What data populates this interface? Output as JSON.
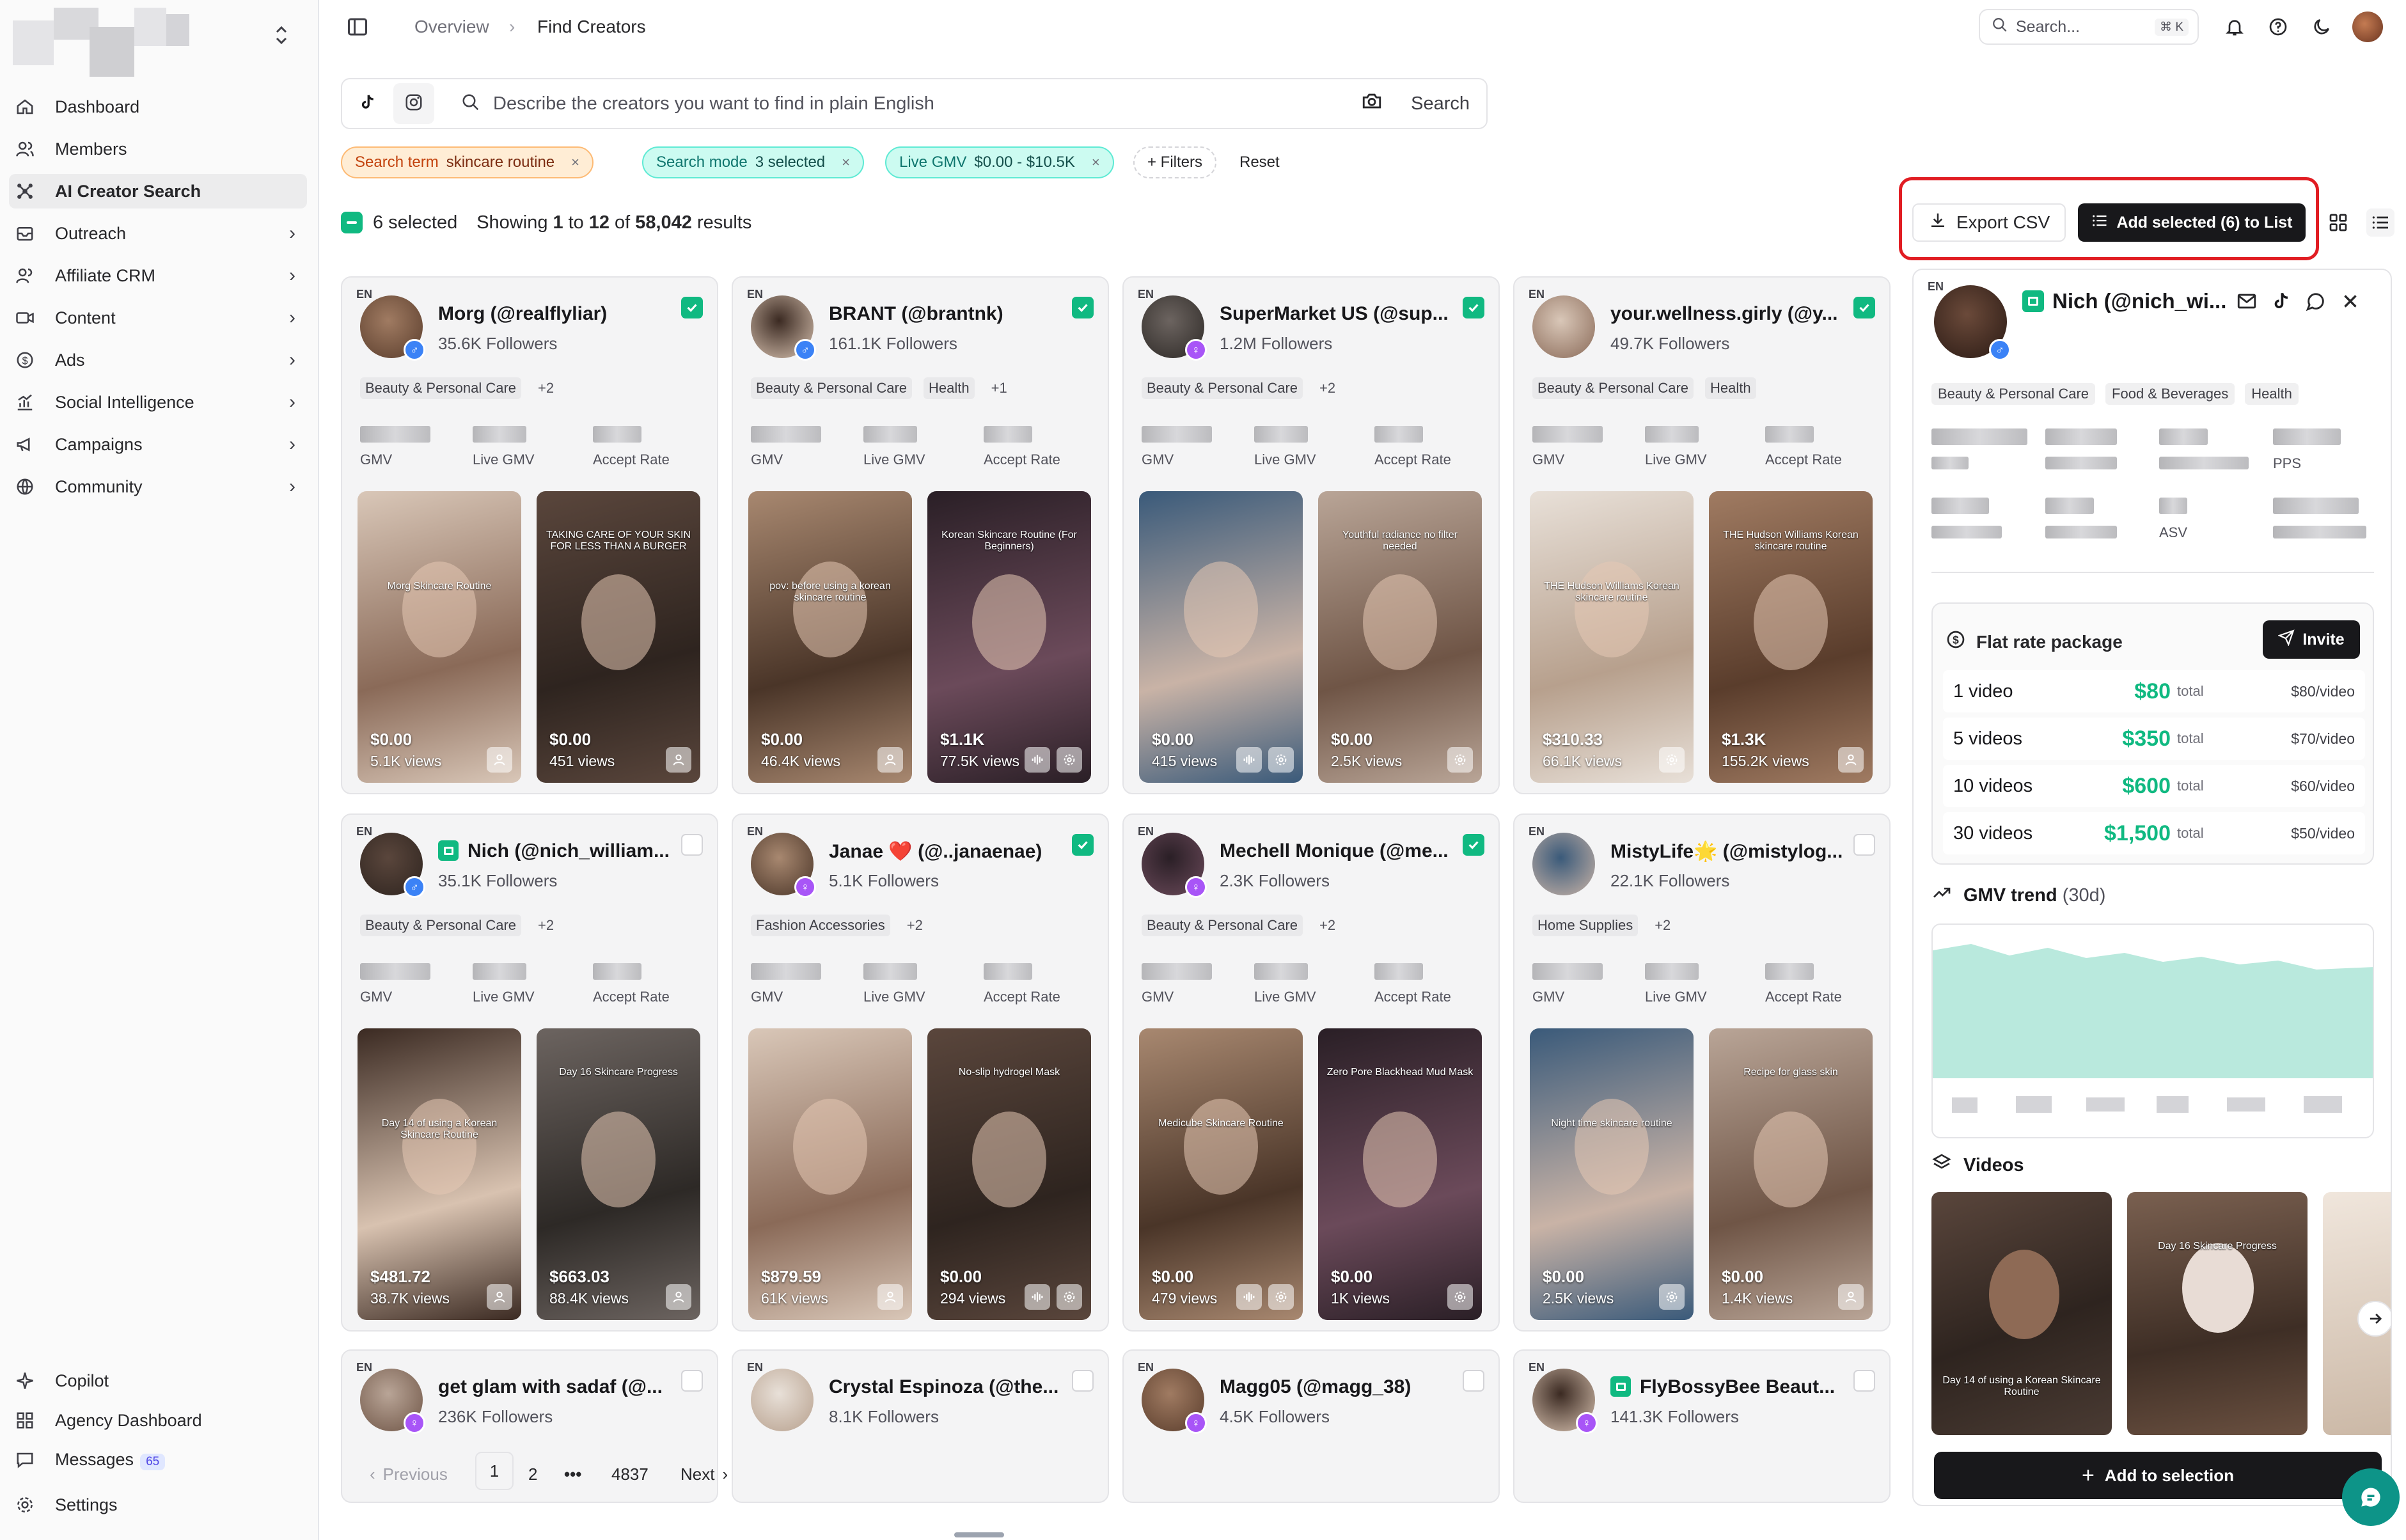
{
  "sidebar": {
    "items": [
      {
        "label": "Dashboard"
      },
      {
        "label": "Members"
      },
      {
        "label": "AI Creator Search"
      },
      {
        "label": "Outreach"
      },
      {
        "label": "Affiliate CRM"
      },
      {
        "label": "Content"
      },
      {
        "label": "Ads"
      },
      {
        "label": "Social Intelligence"
      },
      {
        "label": "Campaigns"
      },
      {
        "label": "Community"
      }
    ],
    "bottom": [
      {
        "label": "Copilot"
      },
      {
        "label": "Agency Dashboard"
      },
      {
        "label": "Messages",
        "badge": "65"
      },
      {
        "label": "Settings"
      }
    ]
  },
  "breadcrumb": {
    "parent": "Overview",
    "sep": "›",
    "current": "Find Creators"
  },
  "topsearch": {
    "placeholder": "Search...",
    "shortcut": "⌘ K"
  },
  "query": {
    "placeholder": "Describe the creators you want to find in plain English",
    "search_label": "Search"
  },
  "chips": {
    "term_label": "Search term",
    "term_value": "skincare routine",
    "mode_label": "Search mode",
    "mode_value": "3 selected",
    "gmv_label": "Live GMV",
    "gmv_value": "$0.00 - $10.5K",
    "filters": "+ Filters",
    "reset": "Reset",
    "remove": "×"
  },
  "results": {
    "selected": "6 selected",
    "showing_prefix": "Showing",
    "from": "1",
    "to_word": "to",
    "to": "12",
    "of_word": "of",
    "total": "58,042",
    "suffix": "results",
    "export": "Export CSV",
    "add_to_list": "Add selected (6) to List"
  },
  "card_labels": {
    "lang": "EN",
    "gmv": "GMV",
    "live_gmv": "Live GMV",
    "accept_rate": "Accept Rate"
  },
  "cards": [
    {
      "name": "Morg (@realflyliar)",
      "followers": "35.6K Followers",
      "gender": "♂",
      "cats": [
        "Beauty & Personal Care",
        "+2"
      ],
      "checked": true,
      "videos": [
        {
          "value": "$0.00",
          "views": "5.1K views",
          "caption": "Morg Skincare Routine"
        },
        {
          "value": "$0.00",
          "views": "451 views",
          "caption": "TAKING CARE OF YOUR SKIN FOR LESS THAN A BURGER"
        }
      ]
    },
    {
      "name": "BRANT (@brantnk)",
      "followers": "161.1K Followers",
      "gender": "♂",
      "cats": [
        "Beauty & Personal Care",
        "Health",
        "+1"
      ],
      "checked": true,
      "videos": [
        {
          "value": "$0.00",
          "views": "46.4K views",
          "caption": "pov: before using a korean skincare routine"
        },
        {
          "value": "$1.1K",
          "views": "77.5K views",
          "caption": "Korean Skincare Routine (For Beginners)"
        }
      ]
    },
    {
      "name": "SuperMarket US (@sup...",
      "followers": "1.2M Followers",
      "gender": "♀",
      "cats": [
        "Beauty & Personal Care",
        "+2"
      ],
      "checked": true,
      "videos": [
        {
          "value": "$0.00",
          "views": "415 views",
          "caption": ""
        },
        {
          "value": "$0.00",
          "views": "2.5K views",
          "caption": "Youthful radiance no filter needed"
        }
      ]
    },
    {
      "name": "your.wellness.girly (@y...",
      "followers": "49.7K Followers",
      "gender": "",
      "cats": [
        "Beauty & Personal Care",
        "Health"
      ],
      "checked": true,
      "videos": [
        {
          "value": "$310.33",
          "views": "66.1K views",
          "caption": "THE Hudson Williams Korean skincare routine"
        },
        {
          "value": "$1.3K",
          "views": "155.2K views",
          "caption": "THE Hudson Williams Korean skincare routine"
        }
      ]
    },
    {
      "name": "Nich (@nich_william...",
      "followers": "35.1K Followers",
      "gender": "♂",
      "cats": [
        "Beauty & Personal Care",
        "+2"
      ],
      "checked": false,
      "shop": true,
      "videos": [
        {
          "value": "$481.72",
          "views": "38.7K views",
          "caption": "Day 14 of using a Korean Skincare Routine"
        },
        {
          "value": "$663.03",
          "views": "88.4K views",
          "caption": "Day 16 Skincare Progress"
        }
      ]
    },
    {
      "name": "Janae ❤️ (@..janaenae)",
      "followers": "5.1K Followers",
      "gender": "♀",
      "cats": [
        "Fashion Accessories",
        "+2"
      ],
      "checked": true,
      "videos": [
        {
          "value": "$879.59",
          "views": "61K views",
          "caption": ""
        },
        {
          "value": "$0.00",
          "views": "294 views",
          "caption": "No-slip hydrogel Mask"
        }
      ]
    },
    {
      "name": "Mechell Monique (@me...",
      "followers": "2.3K Followers",
      "gender": "♀",
      "cats": [
        "Beauty & Personal Care",
        "+2"
      ],
      "checked": true,
      "videos": [
        {
          "value": "$0.00",
          "views": "479 views",
          "caption": "Medicube Skincare Routine"
        },
        {
          "value": "$0.00",
          "views": "1K views",
          "caption": "Zero Pore Blackhead Mud Mask"
        }
      ]
    },
    {
      "name": "MistyLife🌟 (@mistylog...",
      "followers": "22.1K Followers",
      "gender": "",
      "cats": [
        "Home Supplies",
        "+2"
      ],
      "checked": false,
      "videos": [
        {
          "value": "$0.00",
          "views": "2.5K views",
          "caption": "Night time skincare routine"
        },
        {
          "value": "$0.00",
          "views": "1.4K views",
          "caption": "Recipe for glass skin"
        }
      ]
    },
    {
      "name": "get glam with sadaf (@...",
      "followers": "236K Followers",
      "gender": "♀",
      "checked": false
    },
    {
      "name": "Crystal Espinoza (@the...",
      "followers": "8.1K Followers",
      "gender": "",
      "checked": false
    },
    {
      "name": "Magg05 (@magg_38)",
      "followers": "4.5K Followers",
      "gender": "♀",
      "checked": false
    },
    {
      "name": "FlyBossyBee Beaut...",
      "followers": "141.3K Followers",
      "gender": "♀",
      "checked": false,
      "shop": true
    }
  ],
  "pagination": {
    "prev": "Previous",
    "pages": [
      "1",
      "2",
      "•••",
      "4837"
    ],
    "next": "Next"
  },
  "detail": {
    "lang": "EN",
    "name": "Nich (@nich_wi...",
    "cats": [
      "Beauty & Personal Care",
      "Food & Beverages",
      "Health"
    ],
    "metric_pps": "PPS",
    "metric_asv": "ASV",
    "package": {
      "title": "Flat rate package",
      "invite": "Invite",
      "rows": [
        {
          "n": "1 video",
          "total": "$80",
          "tl": "total",
          "per": "$80/video"
        },
        {
          "n": "5 videos",
          "total": "$350",
          "tl": "total",
          "per": "$70/video"
        },
        {
          "n": "10 videos",
          "total": "$600",
          "tl": "total",
          "per": "$60/video"
        },
        {
          "n": "30 videos",
          "total": "$1,500",
          "tl": "total",
          "per": "$50/video"
        }
      ]
    },
    "gmv_trend": "GMV trend",
    "gmv_period": "(30d)",
    "videos_title": "Videos",
    "video_captions": [
      "Day 14 of using a Korean Skincare Routine",
      "Day 16 Skincare Progress"
    ],
    "add_to_selection": "Add to selection"
  },
  "colors": {
    "accent": "#10b981",
    "highlight": "#e11d23",
    "dark": "#18181b"
  }
}
